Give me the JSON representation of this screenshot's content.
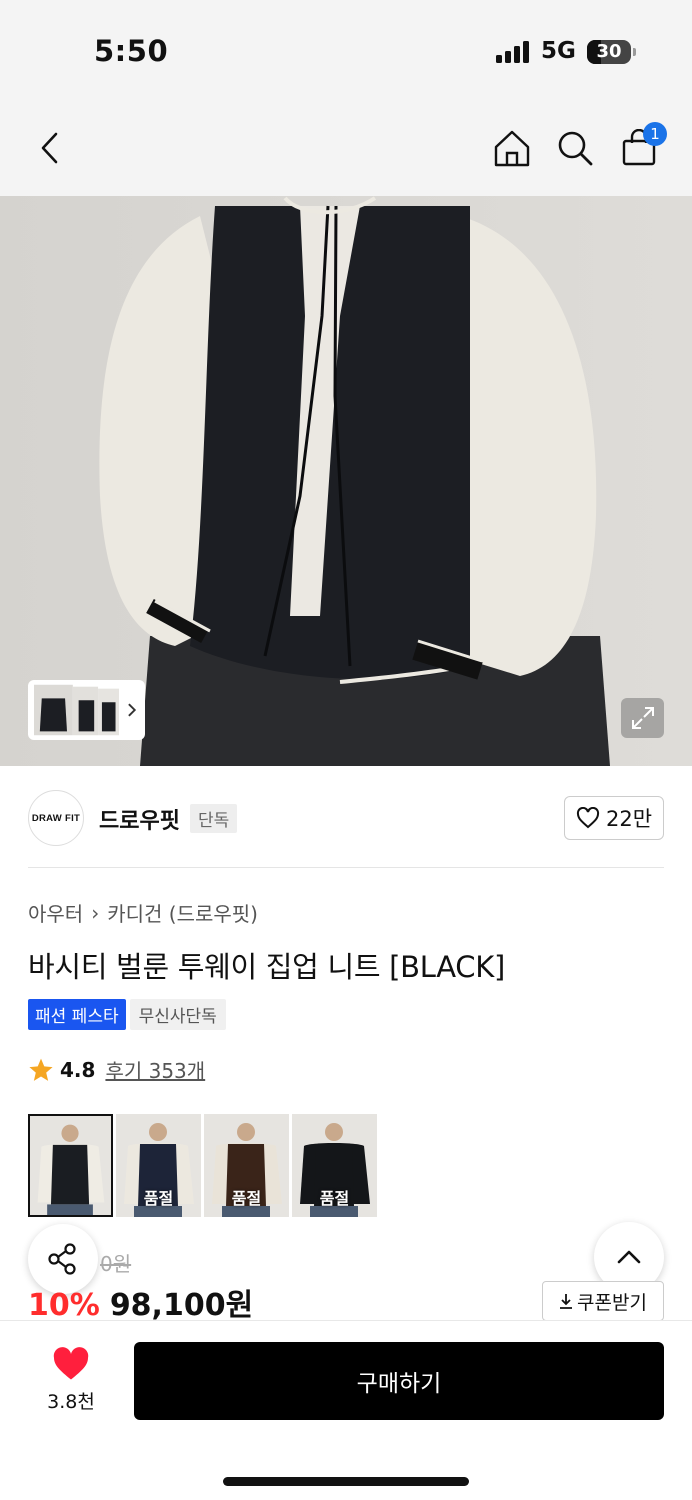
{
  "status_bar": {
    "time": "5:50",
    "network": "5G",
    "battery": "30"
  },
  "nav": {
    "cart_count": "1"
  },
  "brand": {
    "logo_text": "DRAW FIT",
    "name": "드로우핏",
    "tag": "단독",
    "likes": "22만"
  },
  "breadcrumb": {
    "category": "아우터",
    "separator": "›",
    "subcategory": "카디건 (드로우핏)"
  },
  "product": {
    "title": "바시티 벌룬 투웨이 집업 니트 [BLACK]",
    "badges": [
      "패션 페스타",
      "무신사단독"
    ],
    "rating": "4.8",
    "review_label": "후기 353개",
    "original_price": "0원",
    "discount": "10%",
    "price": "98,100원",
    "coupon_label": "쿠폰받기"
  },
  "color_options": [
    {
      "label": "",
      "body": "#1a1d22",
      "sleeve": "#efece4"
    },
    {
      "label": "품절",
      "body": "#1d2438",
      "sleeve": "#ece8df"
    },
    {
      "label": "품절",
      "body": "#3a2419",
      "sleeve": "#e9e3d8"
    },
    {
      "label": "품절",
      "body": "#141619",
      "sleeve": "#141619"
    }
  ],
  "bottom_bar": {
    "wish_count": "3.8천",
    "buy_label": "구매하기"
  },
  "colors": {
    "accent_blue": "#1a56f0",
    "discount_red": "#ff2d2d",
    "heart_red": "#ff1f3d"
  }
}
